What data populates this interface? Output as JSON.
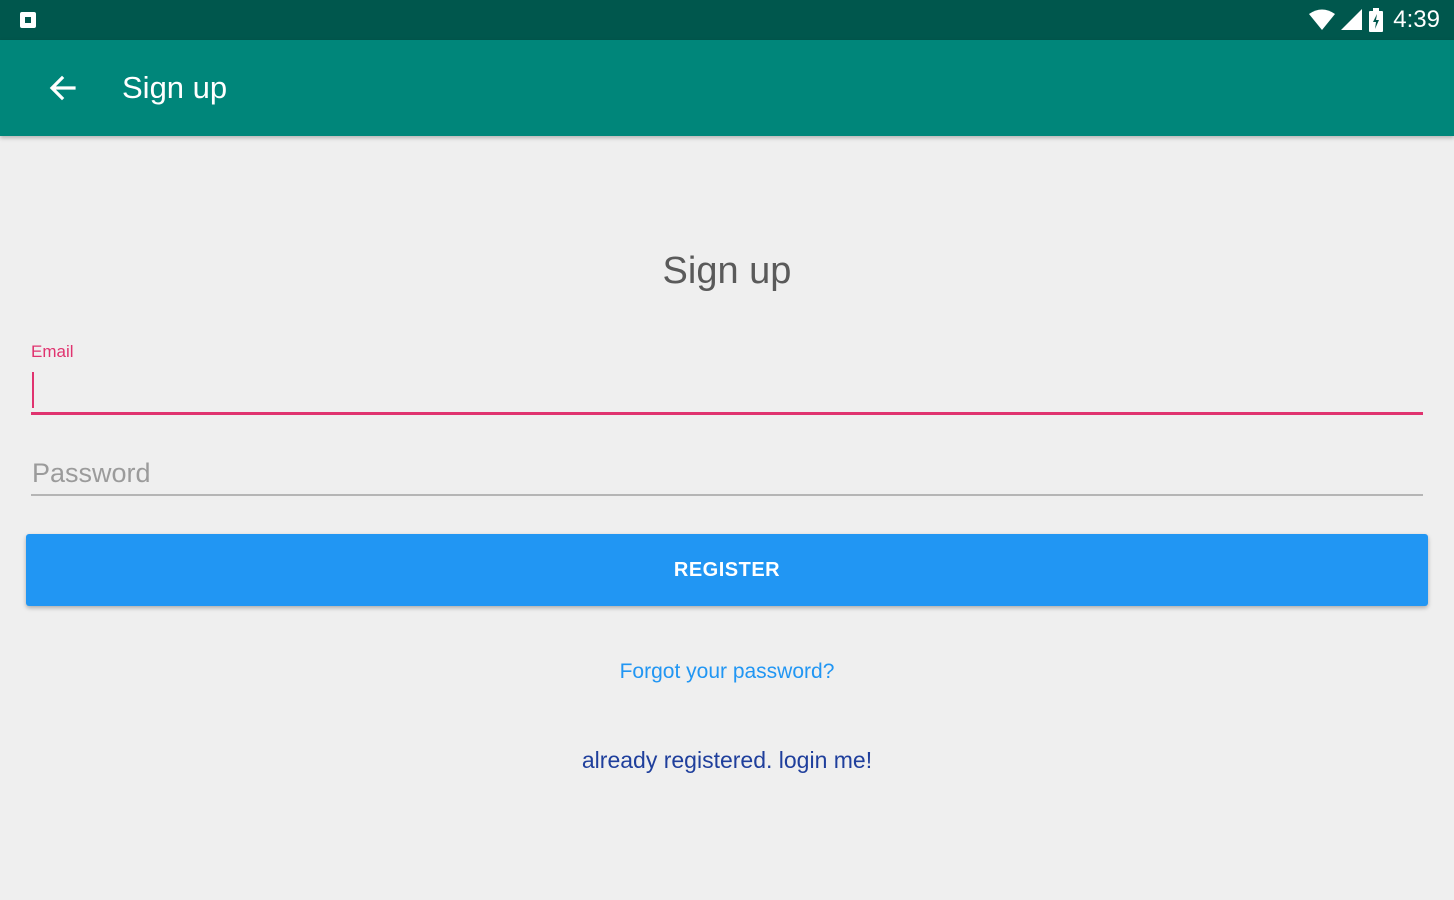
{
  "status_bar": {
    "time": "4:39",
    "background": "#00574d",
    "icons": [
      "notification-icon",
      "wifi-icon",
      "signal-icon",
      "battery-icon"
    ]
  },
  "app_bar": {
    "title": "Sign up",
    "background": "#00867a",
    "back_icon": "arrow-back-icon"
  },
  "form": {
    "heading": "Sign up",
    "email": {
      "label": "Email",
      "value": "",
      "accent": "#e0336f"
    },
    "password": {
      "placeholder": "Password",
      "value": ""
    },
    "register_label": "REGISTER",
    "register_color": "#2196f3",
    "forgot_link": "Forgot your password?",
    "login_link": "already registered. login me!"
  }
}
